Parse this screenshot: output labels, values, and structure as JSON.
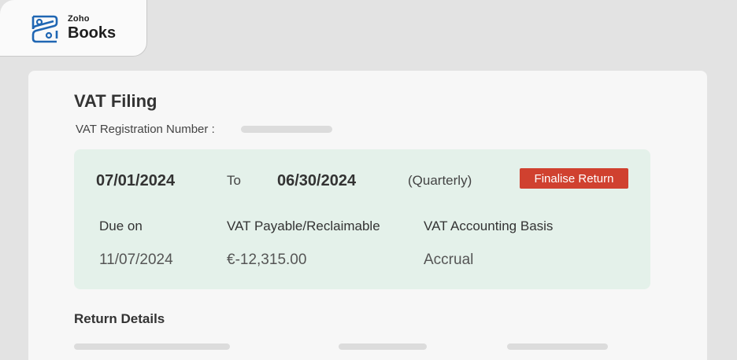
{
  "brand": {
    "top": "Zoho",
    "name": "Books"
  },
  "page": {
    "title": "VAT Filing",
    "registration_label": "VAT Registration Number :"
  },
  "period": {
    "from": "07/01/2024",
    "to_label": "To",
    "to": "06/30/2024",
    "frequency": "(Quarterly)",
    "finalise_label": "Finalise Return"
  },
  "summary": {
    "columns": [
      {
        "label": "Due on",
        "value": "11/07/2024"
      },
      {
        "label": "VAT Payable/Reclaimable",
        "value": "€-12,315.00"
      },
      {
        "label": "VAT Accounting Basis",
        "value": "Accrual"
      }
    ]
  },
  "return_details": {
    "title": "Return Details"
  },
  "colors": {
    "accent_button": "#d0412f",
    "period_bg": "#e4f1ea",
    "logo_blue": "#1f66b3"
  },
  "icons": {
    "logo": "zoho-books-logo-icon"
  }
}
